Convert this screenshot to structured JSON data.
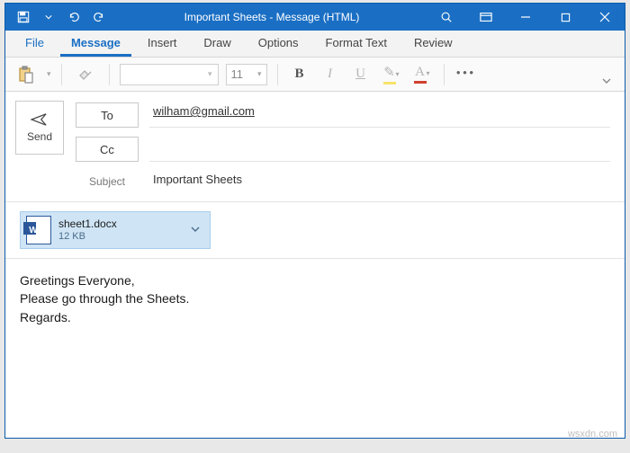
{
  "titlebar": {
    "docname": "Important Sheets",
    "suffix": " -  Message (HTML)"
  },
  "tabs": {
    "file": "File",
    "message": "Message",
    "insert": "Insert",
    "draw": "Draw",
    "options": "Options",
    "format_text": "Format Text",
    "review": "Review"
  },
  "ribbon": {
    "font_size": "11"
  },
  "compose": {
    "send": "Send",
    "to_label": "To",
    "cc_label": "Cc",
    "subject_label": "Subject",
    "to_value": "wilham@gmail.com",
    "cc_value": "",
    "subject_value": "Important Sheets"
  },
  "attachment": {
    "filename": "sheet1.docx",
    "size": "12 KB"
  },
  "body": "Greetings Everyone,\nPlease go through the Sheets.\nRegards.",
  "watermark": "wsxdn.com"
}
